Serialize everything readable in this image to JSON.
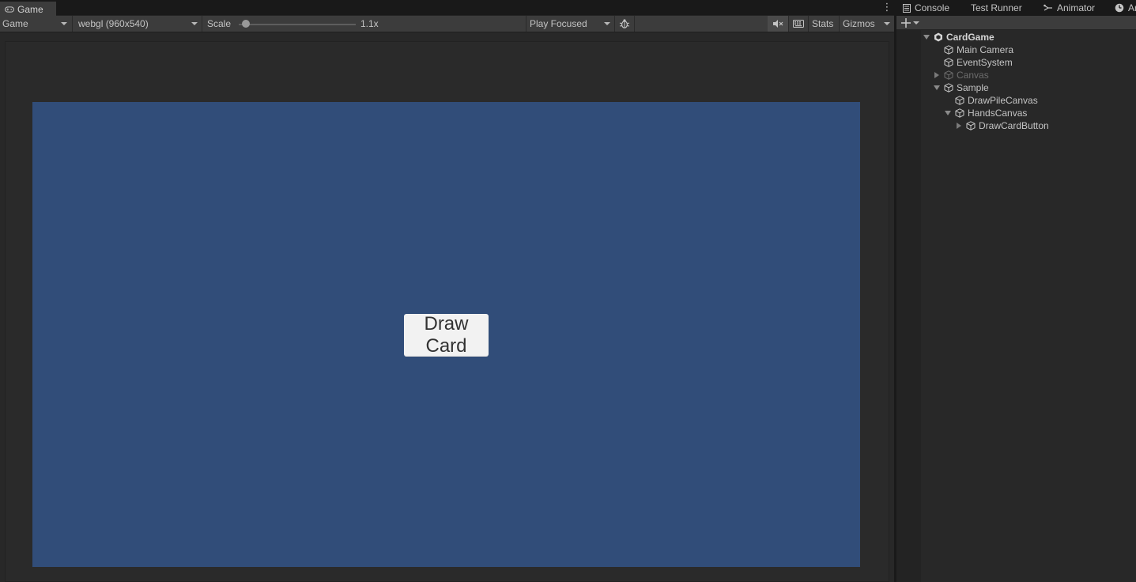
{
  "game_panel": {
    "tab_label": "Game",
    "toolbar": {
      "display_mode": "Game",
      "resolution": "webgl (960x540)",
      "scale_label": "Scale",
      "scale_value": "1.1x",
      "scale_fraction": 0.06,
      "play_mode": "Play Focused",
      "stats_label": "Stats",
      "gizmos_label": "Gizmos"
    },
    "viewport_bg": "#314d79",
    "button_label_line1": "Draw",
    "button_label_line2": "Card"
  },
  "side_tabs": {
    "console": "Console",
    "test_runner": "Test Runner",
    "animator": "Animator",
    "cut_off": "Ar"
  },
  "hierarchy": {
    "items": [
      {
        "label": "CardGame",
        "expanded": true,
        "icon": "unity-scene-icon"
      },
      {
        "label": "Main Camera",
        "icon": "gameobject-cube-icon"
      },
      {
        "label": "EventSystem",
        "icon": "gameobject-cube-icon"
      },
      {
        "label": "Canvas",
        "expanded": false,
        "dimmed": true,
        "icon": "gameobject-cube-icon"
      },
      {
        "label": "Sample",
        "expanded": true,
        "icon": "gameobject-cube-icon"
      },
      {
        "label": "DrawPileCanvas",
        "icon": "gameobject-cube-icon"
      },
      {
        "label": "HandsCanvas",
        "expanded": true,
        "icon": "gameobject-cube-icon"
      },
      {
        "label": "DrawCardButton",
        "expanded": false,
        "icon": "gameobject-cube-icon"
      }
    ]
  }
}
